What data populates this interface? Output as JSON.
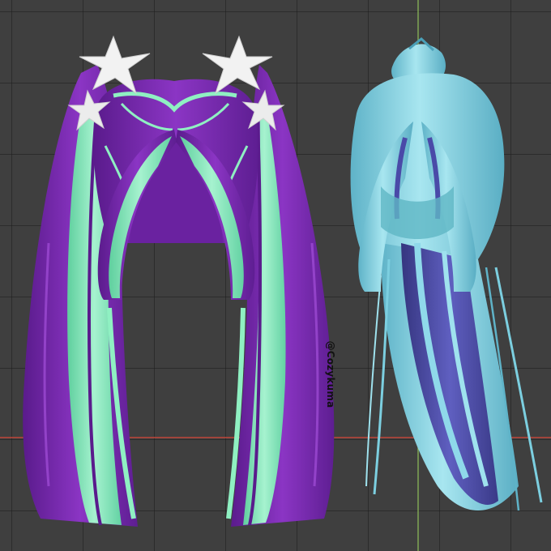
{
  "viewport": {
    "background": "#3f3f3f",
    "grid_color": "#262626",
    "x_axis_color": "#c0463a",
    "y_axis_color": "#8fbf5a"
  },
  "models": [
    {
      "name": "purple-mint-twin-tails-hair",
      "primary_color": "#7a2ab0",
      "secondary_color": "#7fe6b8",
      "accessory": "white-star-clips"
    },
    {
      "name": "cyan-ponytail-hair",
      "primary_color": "#7ccfe0",
      "secondary_color": "#4a4aa8"
    }
  ],
  "watermark": {
    "text": "@Cozykuma"
  }
}
